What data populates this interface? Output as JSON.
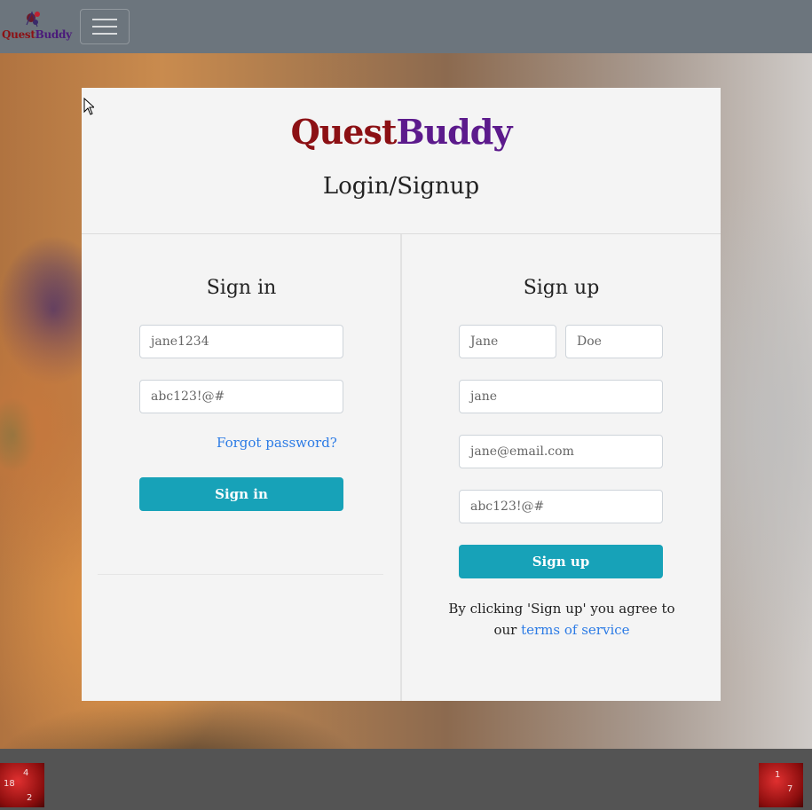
{
  "navbar": {
    "logo_text_1": "Quest",
    "logo_text_2": "Buddy",
    "logo_icon": "dice-icon",
    "menu_icon": "hamburger-menu-icon"
  },
  "card": {
    "brand_part_1": "Quest",
    "brand_part_2": "Buddy",
    "heading": "Login/Signup"
  },
  "sign_in": {
    "title": "Sign in",
    "username_placeholder": "jane1234",
    "password_placeholder": "abc123!@#",
    "forgot_label": "Forgot password?",
    "button_label": "Sign in"
  },
  "sign_up": {
    "title": "Sign up",
    "first_name_placeholder": "Jane",
    "last_name_placeholder": "Doe",
    "username_placeholder": "jane",
    "email_placeholder": "jane@email.com",
    "password_placeholder": "abc123!@#",
    "button_label": "Sign up",
    "terms_text": "By clicking 'Sign up' you agree to our",
    "terms_link": "terms of service"
  },
  "colors": {
    "accent": "#17a2b8",
    "link": "#2c7be5",
    "navbar": "#6c757d",
    "footer": "#545454",
    "brand_red": "#8c1014",
    "brand_purple": "#5c1a8c"
  },
  "footer": {
    "left_icon": "red-die-icon",
    "right_icon": "red-die-icon"
  }
}
